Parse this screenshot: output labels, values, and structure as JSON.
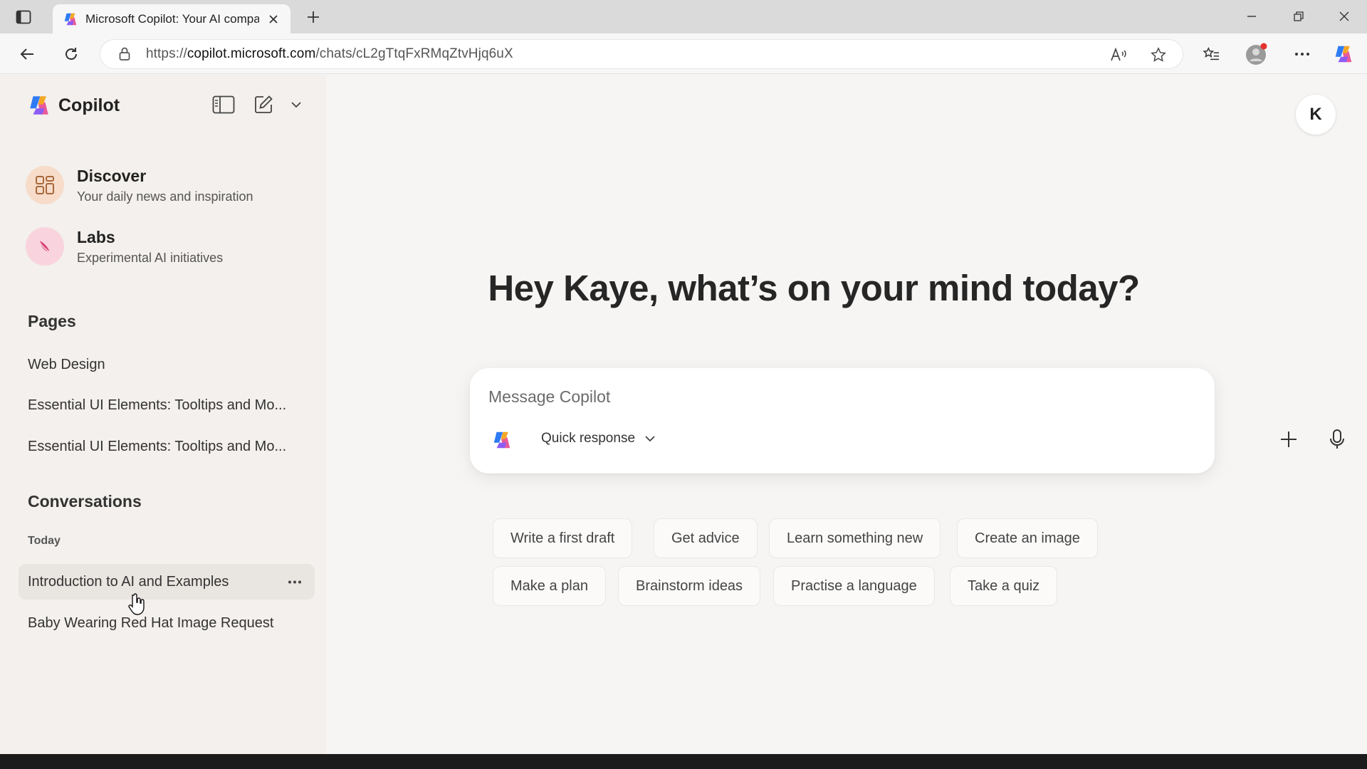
{
  "browser": {
    "tab_title": "Microsoft Copilot: Your AI compa",
    "url_scheme": "https://",
    "url_host": "copilot.microsoft.com",
    "url_path": "/chats/cL2gTtqFxRMqZtvHjq6uX"
  },
  "sidebar": {
    "brand": "Copilot",
    "features": [
      {
        "title": "Discover",
        "subtitle": "Your daily news and inspiration",
        "icon": "grid-icon",
        "color": "#f7d9c4"
      },
      {
        "title": "Labs",
        "subtitle": "Experimental AI initiatives",
        "icon": "flask-icon",
        "color": "#f9d3df"
      }
    ],
    "pages_heading": "Pages",
    "pages": [
      "Web Design",
      "Essential UI Elements: Tooltips and Mo...",
      "Essential UI Elements: Tooltips and Mo..."
    ],
    "conversations_heading": "Conversations",
    "day_label": "Today",
    "conversations": [
      "Introduction to AI and Examples",
      "Baby Wearing Red Hat Image Request"
    ]
  },
  "main": {
    "avatar_initial": "K",
    "greeting": "Hey Kaye, what’s on your mind today?",
    "composer": {
      "placeholder": "Message Copilot",
      "mode_label": "Quick response"
    },
    "suggestions_row1": [
      "Write a first draft",
      "Get advice",
      "Learn something new",
      "Create an image"
    ],
    "suggestions_row2": [
      "Make a plan",
      "Brainstorm ideas",
      "Practise a language",
      "Take a quiz"
    ]
  },
  "colors": {
    "sidebar_bg": "#f3f0ed",
    "main_bg": "#f7f5f3",
    "copilot_blue": "#2f7bf5",
    "copilot_pink": "#e85a9b",
    "copilot_orange": "#f5a623"
  }
}
